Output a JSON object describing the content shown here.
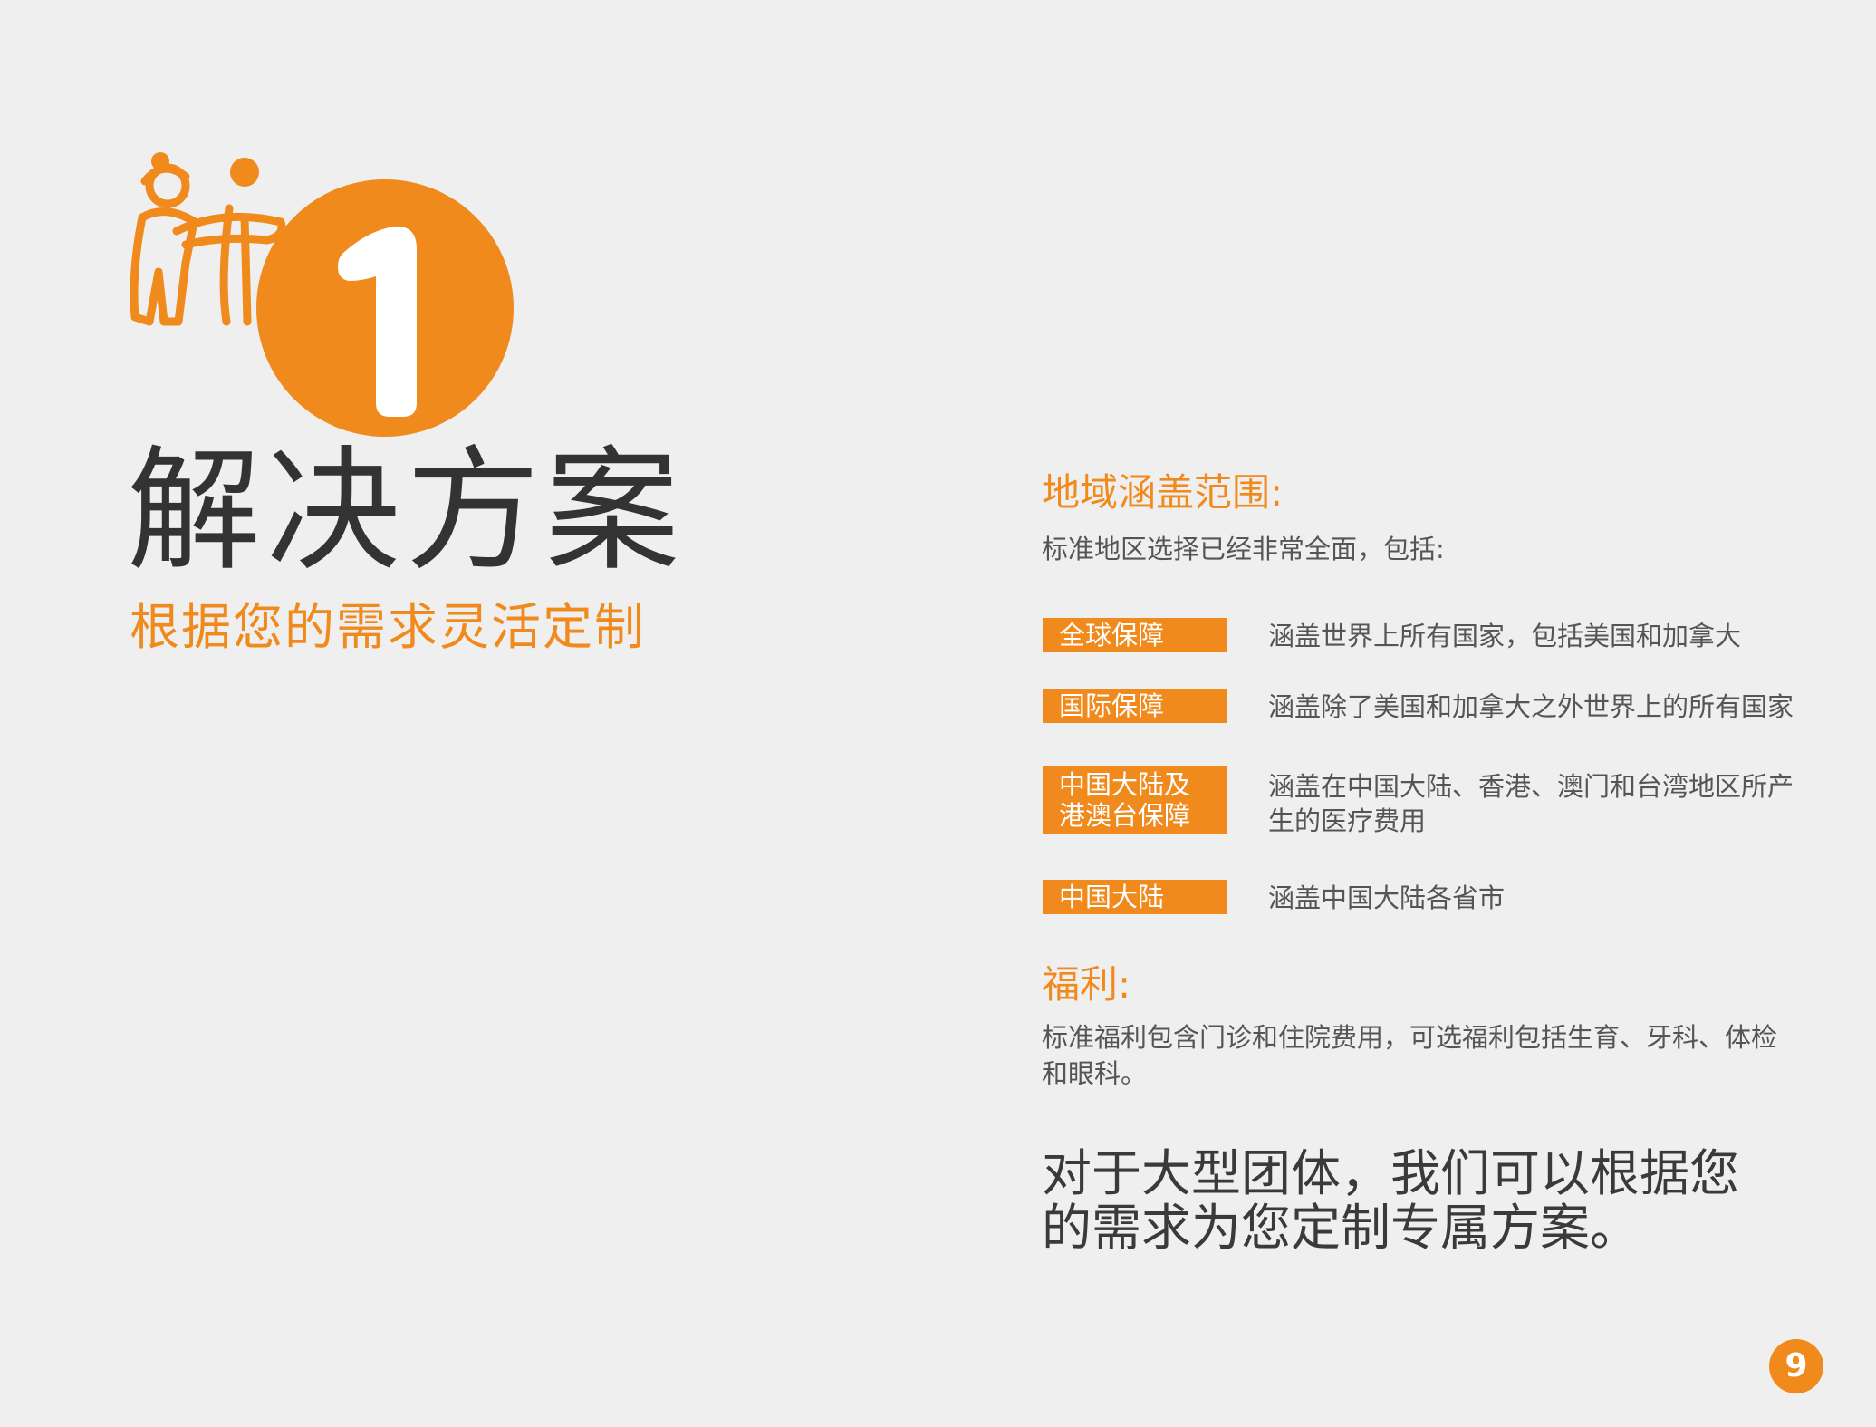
{
  "hero": {
    "number": "1",
    "title": "解决方案",
    "subtitle": "根据您的需求灵活定制"
  },
  "coverage": {
    "heading": "地域涵盖范围:",
    "intro": "标准地区选择已经非常全面，包括:",
    "items": [
      {
        "tag": "全球保障",
        "desc": "涵盖世界上所有国家，包括美国和加拿大"
      },
      {
        "tag": "国际保障",
        "desc": "涵盖除了美国和加拿大之外世界上的所有国家"
      },
      {
        "tag": "中国大陆及\n港澳台保障",
        "desc": "涵盖在中国大陆、香港、澳门和台湾地区所产生的医疗费用"
      },
      {
        "tag": "中国大陆",
        "desc": "涵盖中国大陆各省市"
      }
    ]
  },
  "benefits": {
    "heading": "福利:",
    "text": "标准福利包含门诊和住院费用，可选福利包括生育、牙科、体检和眼科。"
  },
  "closing": "对于大型团体，我们可以根据您的需求为您定制专属方案。",
  "page_number": "9",
  "colors": {
    "accent": "#f08a1c",
    "background": "#efefef",
    "text": "#3a3a3a"
  },
  "icons": {
    "people": "doctor-and-patient-icon"
  }
}
